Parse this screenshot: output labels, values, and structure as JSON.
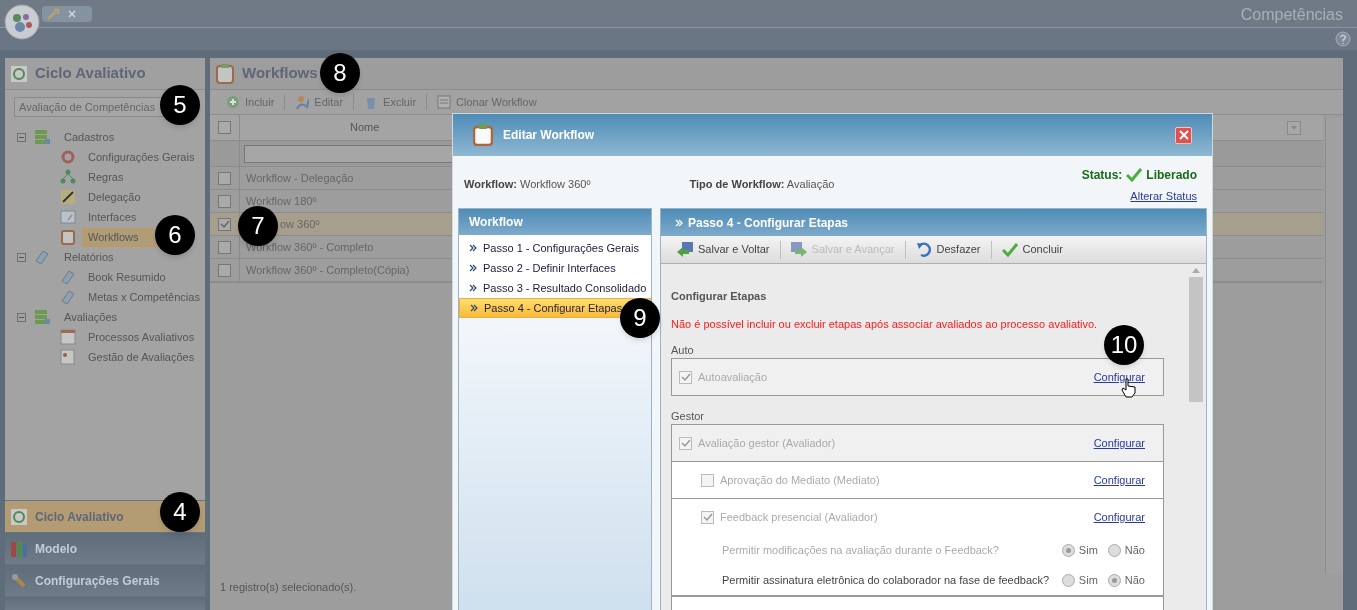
{
  "app": {
    "title": "Competências"
  },
  "left_panel": {
    "title": "Ciclo Avaliativo",
    "dropdown": {
      "value": "Avaliação de Competências"
    },
    "tree": [
      {
        "label": "Cadastros",
        "expanded": true,
        "children": [
          {
            "label": "Configurações Gerais",
            "selected": false
          },
          {
            "label": "Regras",
            "selected": false
          },
          {
            "label": "Delegação",
            "selected": false
          },
          {
            "label": "Interfaces",
            "selected": false
          },
          {
            "label": "Workflows",
            "selected": true
          }
        ]
      },
      {
        "label": "Relatórios",
        "expanded": true,
        "children": [
          {
            "label": "Book Resumido",
            "selected": false
          },
          {
            "label": "Metas x Competências",
            "selected": false
          }
        ]
      },
      {
        "label": "Avaliações",
        "expanded": true,
        "children": [
          {
            "label": "Processos Avaliativos",
            "selected": false
          },
          {
            "label": "Gestão de Avaliações",
            "selected": false
          }
        ]
      }
    ],
    "accordion": [
      {
        "label": "Ciclo Avaliativo",
        "selected": true
      },
      {
        "label": "Modelo",
        "selected": false
      },
      {
        "label": "Configurações Gerais",
        "selected": false
      }
    ]
  },
  "main": {
    "title": "Workflows",
    "all_checked": false,
    "toolbar": [
      "Incluir",
      "Editar",
      "Excluir",
      "Clonar Workflow"
    ],
    "columns": [
      "Nome"
    ],
    "rows": [
      {
        "name": "Workflow - Delegação",
        "checked": false
      },
      {
        "name": "Workflow 180º",
        "checked": false
      },
      {
        "name": "ow 360º",
        "checked": true
      },
      {
        "name": "Workflow 360º - Completo",
        "checked": false
      },
      {
        "name": "Workflow 360º - Completo(Cópia)",
        "checked": false
      }
    ],
    "status": "1 registro(s) selecionado(s)."
  },
  "dialog": {
    "title": "Editar Workflow",
    "info": [
      {
        "label": "Workflow:",
        "value": "Workflow 360º"
      },
      {
        "label": "Tipo de Workflow:",
        "value": "Avaliação"
      }
    ],
    "status": {
      "label": "Status:",
      "value": "Liberado",
      "link": "Alterar Status"
    },
    "steps_title": "Workflow",
    "steps": [
      {
        "label": "Passo 1 - Configurações Gerais",
        "selected": false
      },
      {
        "label": "Passo 2 - Definir Interfaces",
        "selected": false
      },
      {
        "label": "Passo 3 - Resultado Consolidado",
        "selected": false
      },
      {
        "label": "Passo 4 - Configurar Etapas",
        "selected": true
      }
    ],
    "panel_title": "Passo 4 - Configurar Etapas",
    "toolbar": [
      {
        "label": "Salvar e Voltar",
        "disabled": false
      },
      {
        "label": "Salvar e Avançar",
        "disabled": true
      },
      {
        "label": "Desfazer",
        "disabled": false
      },
      {
        "label": "Concluir",
        "disabled": false
      }
    ],
    "section_title": "Configurar Etapas",
    "warning": "Não é possível incluir ou excluir etapas após associar avaliados ao processo avaliativo.",
    "groups": [
      {
        "label": "Auto",
        "stages": [
          {
            "label": "Autoavaliação",
            "checked": true,
            "link": "Configurar"
          }
        ]
      },
      {
        "label": "Gestor",
        "stages": [
          {
            "label": "Avaliação gestor (Avaliador)",
            "checked": true,
            "link": "Configurar",
            "children": [
              {
                "label": "Aprovação do Mediato (Mediato)",
                "checked": false,
                "link": "Configurar"
              },
              {
                "label": "Feedback presencial (Avaliador)",
                "checked": true,
                "link": "Configurar",
                "questions": [
                  {
                    "text": "Permitir modificações na avaliação durante o Feedback?",
                    "disabled": true,
                    "options": [
                      {
                        "label": "Sim",
                        "selected": true
                      },
                      {
                        "label": "Não",
                        "selected": false
                      }
                    ]
                  },
                  {
                    "text": "Permitir assinatura eletrônica do colaborador na fase de feedback?",
                    "disabled": false,
                    "options": [
                      {
                        "label": "Sim",
                        "selected": false
                      },
                      {
                        "label": "Não",
                        "selected": true
                      }
                    ]
                  }
                ]
              }
            ]
          }
        ]
      }
    ]
  },
  "callouts": [
    "8",
    "5",
    "6",
    "7",
    "4",
    "9",
    "10"
  ]
}
